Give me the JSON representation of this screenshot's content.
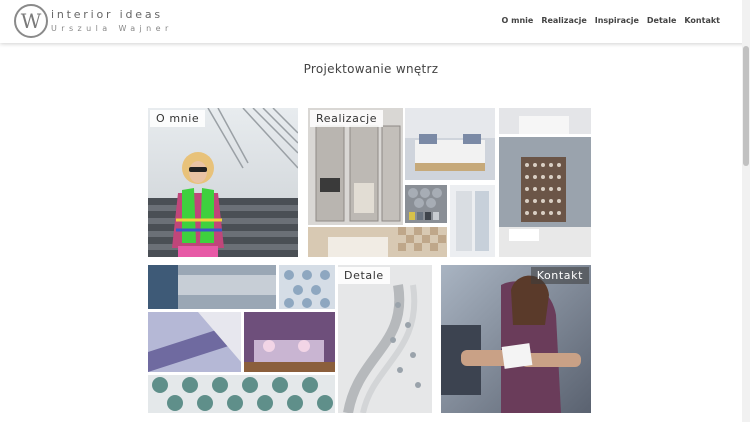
{
  "brand": {
    "logo_letter": "W",
    "title": "interior ideas",
    "subtitle": "Urszula Wajner"
  },
  "nav": {
    "items": [
      "O mnie",
      "Realizacje",
      "Inspiracje",
      "Detale",
      "Kontakt"
    ]
  },
  "page": {
    "title": "Projektowanie wnętrz"
  },
  "tiles": {
    "o_mnie": "O mnie",
    "realizacje": "Realizacje",
    "detale": "Detale",
    "kontakt": "Kontakt"
  }
}
